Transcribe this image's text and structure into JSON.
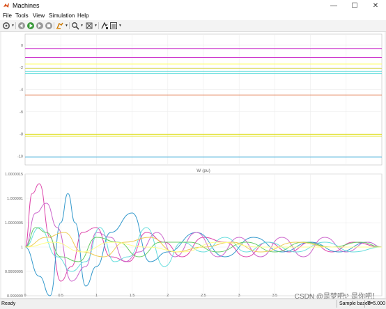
{
  "window": {
    "title": "Machines",
    "controls": [
      "—",
      "☐",
      "✕"
    ]
  },
  "menu": [
    "File",
    "Tools",
    "View",
    "Simulation",
    "Help"
  ],
  "toolbar_icons": [
    "settings-icon",
    "back-icon",
    "run-icon",
    "stop-icon",
    "step-icon",
    "highlight-icon",
    "zoom-icon",
    "fit-icon",
    "cursor-icon",
    "legend-icon"
  ],
  "chart_data": [
    {
      "type": "line",
      "title": "",
      "xlabel": "",
      "ylabel": "",
      "xlim": [
        0,
        5
      ],
      "ylim": [
        -10.8,
        1
      ],
      "x_ticks": [],
      "y_ticks": [
        "0",
        "-2",
        "-4",
        "-6",
        "-8",
        "-10"
      ],
      "grid": true,
      "series": [
        {
          "color": "#cc33cc",
          "values": [
            {
              "x": 0,
              "y": -0.3
            },
            {
              "x": 5,
              "y": -0.3
            }
          ]
        },
        {
          "color": "#cc33cc",
          "values": [
            {
              "x": 0,
              "y": -1.1
            },
            {
              "x": 5,
              "y": -1.1
            }
          ]
        },
        {
          "color": "#ffff66",
          "values": [
            {
              "x": 0,
              "y": -1.7
            },
            {
              "x": 5,
              "y": -1.7
            }
          ]
        },
        {
          "color": "#dddd66",
          "values": [
            {
              "x": 0,
              "y": -2.1
            },
            {
              "x": 5,
              "y": -2.1
            }
          ]
        },
        {
          "color": "#66dddd",
          "values": [
            {
              "x": 0,
              "y": -2.35
            },
            {
              "x": 5,
              "y": -2.35
            }
          ]
        },
        {
          "color": "#66dddd",
          "values": [
            {
              "x": 0,
              "y": -2.55
            },
            {
              "x": 5,
              "y": -2.55
            }
          ]
        },
        {
          "color": "#dd6633",
          "values": [
            {
              "x": 0,
              "y": -4.5
            },
            {
              "x": 5,
              "y": -4.5
            }
          ]
        },
        {
          "color": "#dddd00",
          "values": [
            {
              "x": 0,
              "y": -8.05
            },
            {
              "x": 5,
              "y": -8.05
            }
          ]
        },
        {
          "color": "#dddd00",
          "values": [
            {
              "x": 0,
              "y": -8.2
            },
            {
              "x": 5,
              "y": -8.2
            }
          ]
        },
        {
          "color": "#33aadd",
          "values": [
            {
              "x": 0,
              "y": -10.1
            },
            {
              "x": 5,
              "y": -10.1
            }
          ]
        }
      ]
    },
    {
      "type": "line",
      "title": "W (pu)",
      "xlabel": "",
      "ylabel": "",
      "xlim": [
        0,
        5
      ],
      "ylim": [
        0.999999,
        1.0000015
      ],
      "x_ticks": [
        "0",
        "0.5",
        "1",
        "1.5",
        "2",
        "2.5",
        "3",
        "3.5",
        "4",
        "4.5"
      ],
      "y_ticks": [
        "1.0000015",
        "1.000001",
        "1.0000005",
        "1",
        "0.9999995",
        "0.999999"
      ],
      "grid": true,
      "series": [
        {
          "color": "#dd44aa",
          "values": [
            {
              "x": 0,
              "y": 1
            },
            {
              "x": 0.1,
              "y": 1.0000011
            },
            {
              "x": 0.2,
              "y": 1.0000013
            },
            {
              "x": 0.35,
              "y": 1.0000002
            },
            {
              "x": 0.5,
              "y": 0.9999993
            },
            {
              "x": 0.65,
              "y": 0.9999996
            },
            {
              "x": 0.8,
              "y": 1.0000003
            },
            {
              "x": 1.0,
              "y": 1.0000004
            },
            {
              "x": 1.2,
              "y": 0.9999998
            },
            {
              "x": 1.45,
              "y": 0.9999997
            },
            {
              "x": 1.7,
              "y": 1.0000003
            },
            {
              "x": 1.95,
              "y": 1.0000001
            },
            {
              "x": 2.2,
              "y": 0.9999998
            },
            {
              "x": 2.5,
              "y": 1.0000002
            },
            {
              "x": 2.8,
              "y": 1.0000001
            },
            {
              "x": 3.1,
              "y": 0.9999998
            },
            {
              "x": 3.4,
              "y": 1.0000001
            },
            {
              "x": 3.7,
              "y": 0.9999999
            },
            {
              "x": 4.0,
              "y": 1.0000001
            },
            {
              "x": 4.3,
              "y": 0.9999999
            },
            {
              "x": 4.6,
              "y": 1.0000001
            },
            {
              "x": 5,
              "y": 1
            }
          ]
        },
        {
          "color": "#3399cc",
          "values": [
            {
              "x": 0,
              "y": 1
            },
            {
              "x": 0.2,
              "y": 0.9999994
            },
            {
              "x": 0.35,
              "y": 0.999999
            },
            {
              "x": 0.5,
              "y": 1.0000005
            },
            {
              "x": 0.6,
              "y": 1.0000011
            },
            {
              "x": 0.7,
              "y": 1.0000005
            },
            {
              "x": 0.85,
              "y": 0.9999992
            },
            {
              "x": 1.0,
              "y": 0.9999996
            },
            {
              "x": 1.2,
              "y": 1.0000003
            },
            {
              "x": 1.5,
              "y": 1.0000007
            },
            {
              "x": 1.75,
              "y": 0.9999997
            },
            {
              "x": 2.0,
              "y": 0.9999999
            },
            {
              "x": 2.4,
              "y": 1.0000003
            },
            {
              "x": 2.8,
              "y": 0.9999998
            },
            {
              "x": 3.2,
              "y": 1.0000002
            },
            {
              "x": 3.6,
              "y": 0.9999999
            },
            {
              "x": 4.0,
              "y": 1.0000001
            },
            {
              "x": 4.4,
              "y": 0.9999999
            },
            {
              "x": 4.8,
              "y": 1.0000001
            },
            {
              "x": 5,
              "y": 1
            }
          ]
        },
        {
          "color": "#cc66cc",
          "values": [
            {
              "x": 0,
              "y": 1
            },
            {
              "x": 0.15,
              "y": 1.0000007
            },
            {
              "x": 0.3,
              "y": 1.0000009
            },
            {
              "x": 0.45,
              "y": 1.0000004
            },
            {
              "x": 0.65,
              "y": 0.9999993
            },
            {
              "x": 0.85,
              "y": 0.9999996
            },
            {
              "x": 1.0,
              "y": 1.0000003
            },
            {
              "x": 1.2,
              "y": 1.0000002
            },
            {
              "x": 1.4,
              "y": 0.9999997
            },
            {
              "x": 1.6,
              "y": 0.9999999
            },
            {
              "x": 1.85,
              "y": 1.0000003
            },
            {
              "x": 2.1,
              "y": 0.9999998
            },
            {
              "x": 2.4,
              "y": 1.0000003
            },
            {
              "x": 2.7,
              "y": 0.9999998
            },
            {
              "x": 3.0,
              "y": 1.0000002
            },
            {
              "x": 3.3,
              "y": 0.9999998
            },
            {
              "x": 3.6,
              "y": 1.0000002
            },
            {
              "x": 3.9,
              "y": 0.9999998
            },
            {
              "x": 4.2,
              "y": 1.0000002
            },
            {
              "x": 4.5,
              "y": 0.9999999
            },
            {
              "x": 4.8,
              "y": 1.0000001
            },
            {
              "x": 5,
              "y": 1
            }
          ]
        },
        {
          "color": "#66dddd",
          "values": [
            {
              "x": 0,
              "y": 1
            },
            {
              "x": 0.2,
              "y": 1.0000004
            },
            {
              "x": 0.45,
              "y": 0.9999998
            },
            {
              "x": 0.65,
              "y": 0.9999995
            },
            {
              "x": 0.85,
              "y": 0.9999997
            },
            {
              "x": 1.05,
              "y": 1.0000004
            },
            {
              "x": 1.25,
              "y": 0.9999997
            },
            {
              "x": 1.45,
              "y": 0.9999998
            },
            {
              "x": 1.7,
              "y": 1.0000004
            },
            {
              "x": 1.95,
              "y": 0.9999996
            },
            {
              "x": 2.2,
              "y": 1.0000001
            },
            {
              "x": 2.5,
              "y": 0.9999999
            },
            {
              "x": 2.8,
              "y": 1.0000002
            },
            {
              "x": 3.1,
              "y": 0.9999999
            },
            {
              "x": 3.4,
              "y": 1.0000001
            },
            {
              "x": 3.8,
              "y": 0.9999999
            },
            {
              "x": 4.2,
              "y": 1.0000001
            },
            {
              "x": 4.6,
              "y": 0.9999999
            },
            {
              "x": 5,
              "y": 1
            }
          ]
        },
        {
          "color": "#66cc66",
          "values": [
            {
              "x": 0,
              "y": 1
            },
            {
              "x": 0.15,
              "y": 1.0000004
            },
            {
              "x": 0.3,
              "y": 1.0000003
            },
            {
              "x": 0.5,
              "y": 0.9999998
            },
            {
              "x": 0.75,
              "y": 0.9999997
            },
            {
              "x": 1.0,
              "y": 1.0000002
            },
            {
              "x": 1.3,
              "y": 1.0000001
            },
            {
              "x": 1.6,
              "y": 0.9999998
            },
            {
              "x": 1.9,
              "y": 1.0000001
            },
            {
              "x": 2.3,
              "y": 1.0000001
            },
            {
              "x": 2.7,
              "y": 0.9999999
            },
            {
              "x": 3.1,
              "y": 1.0000001
            },
            {
              "x": 3.5,
              "y": 0.9999999
            },
            {
              "x": 3.9,
              "y": 1.0000001
            },
            {
              "x": 4.3,
              "y": 1.0
            },
            {
              "x": 4.7,
              "y": 1.0000001
            },
            {
              "x": 5,
              "y": 1
            }
          ]
        },
        {
          "color": "#eecc55",
          "values": [
            {
              "x": 0,
              "y": 1
            },
            {
              "x": 0.3,
              "y": 1.0000002
            },
            {
              "x": 0.55,
              "y": 1.0000003
            },
            {
              "x": 0.8,
              "y": 0.9999999
            },
            {
              "x": 1.1,
              "y": 0.9999998
            },
            {
              "x": 1.4,
              "y": 1.0000001
            },
            {
              "x": 1.75,
              "y": 1.0000002
            },
            {
              "x": 2.1,
              "y": 0.9999999
            },
            {
              "x": 2.5,
              "y": 1.0
            },
            {
              "x": 2.9,
              "y": 1.0000001
            },
            {
              "x": 3.3,
              "y": 0.9999999
            },
            {
              "x": 3.8,
              "y": 1.0000001
            },
            {
              "x": 4.3,
              "y": 1.0
            },
            {
              "x": 5,
              "y": 1
            }
          ]
        },
        {
          "color": "#ffff88",
          "values": [
            {
              "x": 0,
              "y": 1
            },
            {
              "x": 0.4,
              "y": 1.0000001
            },
            {
              "x": 0.8,
              "y": 0.9999999
            },
            {
              "x": 1.2,
              "y": 1.0000001
            },
            {
              "x": 1.7,
              "y": 1.0
            },
            {
              "x": 2.2,
              "y": 0.9999999
            },
            {
              "x": 2.7,
              "y": 1.0000001
            },
            {
              "x": 3.3,
              "y": 1.0
            },
            {
              "x": 4.0,
              "y": 1.0
            },
            {
              "x": 5,
              "y": 1
            }
          ]
        }
      ]
    }
  ],
  "status": {
    "left": "Ready",
    "sample": "Sample based",
    "time": "T=5.000"
  },
  "watermark": "CSDN @是梦吧，是你吧！"
}
